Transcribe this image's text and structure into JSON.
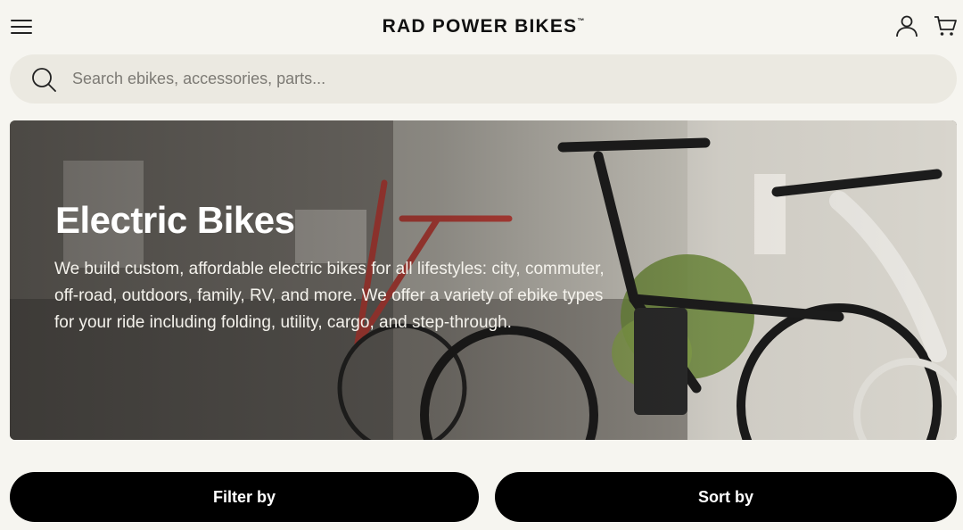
{
  "header": {
    "brand": "RAD POWER BIKES",
    "brand_tm": "™",
    "icons": [
      "menu-icon",
      "account-icon",
      "cart-icon"
    ]
  },
  "search": {
    "placeholder": "Search ebikes, accessories, parts...",
    "value": "",
    "icon": "search-icon"
  },
  "hero": {
    "title": "Electric Bikes",
    "description": "We build custom, affordable electric bikes for all lifestyles: city, commuter, off-road, outdoors, family, RV, and more. We offer a variety of ebike types for your ride including folding, utility, cargo, and step-through."
  },
  "actions": {
    "filter_label": "Filter by",
    "sort_label": "Sort by"
  },
  "colors": {
    "background": "#f6f5f0",
    "search_bg": "#ebe9e1",
    "button_bg": "#000000",
    "button_text": "#ffffff"
  }
}
